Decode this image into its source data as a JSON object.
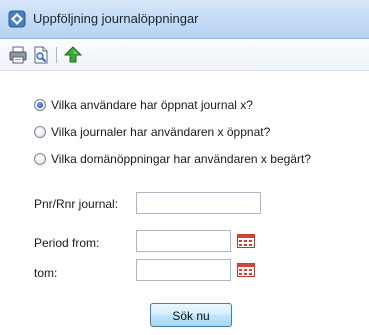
{
  "window": {
    "title": "Uppföljning journalöppningar"
  },
  "toolbar": {
    "buttons": [
      {
        "icon": "printer-icon",
        "label": ""
      },
      {
        "icon": "print-preview-icon",
        "label": ""
      },
      {
        "icon": "up-arrow-icon",
        "label": ""
      }
    ]
  },
  "questions": {
    "options": [
      {
        "label": "Vilka användare har öppnat journal x?",
        "checked": true
      },
      {
        "label": "Vilka journaler har användaren x öppnat?",
        "checked": false
      },
      {
        "label": "Vilka domänöppningar har användaren x begärt?",
        "checked": false
      }
    ]
  },
  "form": {
    "pnr_label": "Pnr/Rnr journal:",
    "pnr_value": "",
    "period_from_label": "Period from:",
    "period_from_value": "",
    "period_to_label": "tom:",
    "period_to_value": ""
  },
  "actions": {
    "search_label": "Sök nu"
  },
  "colors": {
    "titlebar": "#c3dbf6",
    "accent_blue": "#1f5fb3",
    "calendar_red": "#d9403a"
  }
}
